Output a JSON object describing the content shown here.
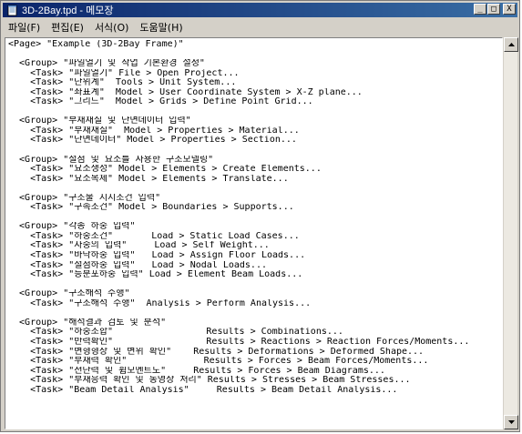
{
  "window": {
    "title": "3D-2Bay.tpd - 메모장",
    "minimize_label": "_",
    "maximize_label": "□",
    "close_label": "X"
  },
  "menu": [
    {
      "label": "파일(F)"
    },
    {
      "label": "편집(E)"
    },
    {
      "label": "서식(O)"
    },
    {
      "label": "도움말(H)"
    }
  ],
  "editor": {
    "lines": [
      "<Page> \"Example (3D-2Bay Frame)\"",
      "",
      "  <Group> \"파일열기 및 작업 기본환경 설정\"",
      "    <Task> \"파일열기\" File > Open Project...",
      "    <Task> \"단위계\"  Tools > Unit System...",
      "    <Task> \"좌표계\"  Model > User Coordinate System > X-Z plane...",
      "    <Task> \"그리드\"  Model > Grids > Define Point Grid...",
      "",
      "  <Group> \"부재재질 및 단면데이터 입력\"",
      "    <Task> \"부재재질\"  Model > Properties > Material...",
      "    <Task> \"단면데이터\" Model > Properties > Section...",
      "",
      "  <Group> \"절점 및 요소를 사용한 구조모델링\"",
      "    <Task> \"요소생성\" Model > Elements > Create Elements...",
      "    <Task> \"요소복제\" Model > Elements > Translate...",
      "",
      "  <Group> \"구조물 지지조건 입력\"",
      "    <Task> \"구속조건\" Model > Boundaries > Supports...",
      "",
      "  <Group> \"각종 하중 입력\"",
      "    <Task> \"하중조건\"       Load > Static Load Cases...",
      "    <Task> \"자중의 입력\"     Load > Self Weight...",
      "    <Task> \"바닥하중 입력\"   Load > Assign Floor Loads...",
      "    <Task> \"절점하중 입력\"   Load > Nodal Loads...",
      "    <Task> \"등분포하중 입력\" Load > Element Beam Loads...",
      "",
      "  <Group> \"구조해석 수행\"",
      "    <Task> \"구조해석 수행\"  Analysis > Perform Analysis...",
      "",
      "  <Group> \"해석결과 검토 및 분석\"",
      "    <Task> \"하중조합\"                 Results > Combinations...",
      "    <Task> \"반력확인\"                 Results > Reactions > Reaction Forces/Moments...",
      "    <Task> \"변형형상 및 변위 확인\"    Results > Deformations > Deformed Shape...",
      "    <Task> \"부재력 확인\"              Results > Forces > Beam Forces/Moments...",
      "    <Task> \"전단력 및 휨모멘트도\"     Results > Forces > Beam Diagrams...",
      "    <Task> \"부재응력 확인 및 동영상 처리\" Results > Stresses > Beam Stresses...",
      "    <Task> \"Beam Detail Analysis\"     Results > Beam Detail Analysis..."
    ]
  },
  "colors": {
    "titlebar_start": "#0a246a",
    "titlebar_end": "#3a6ea5",
    "chrome": "#d4d0c8",
    "editor_bg": "#ffffff"
  }
}
